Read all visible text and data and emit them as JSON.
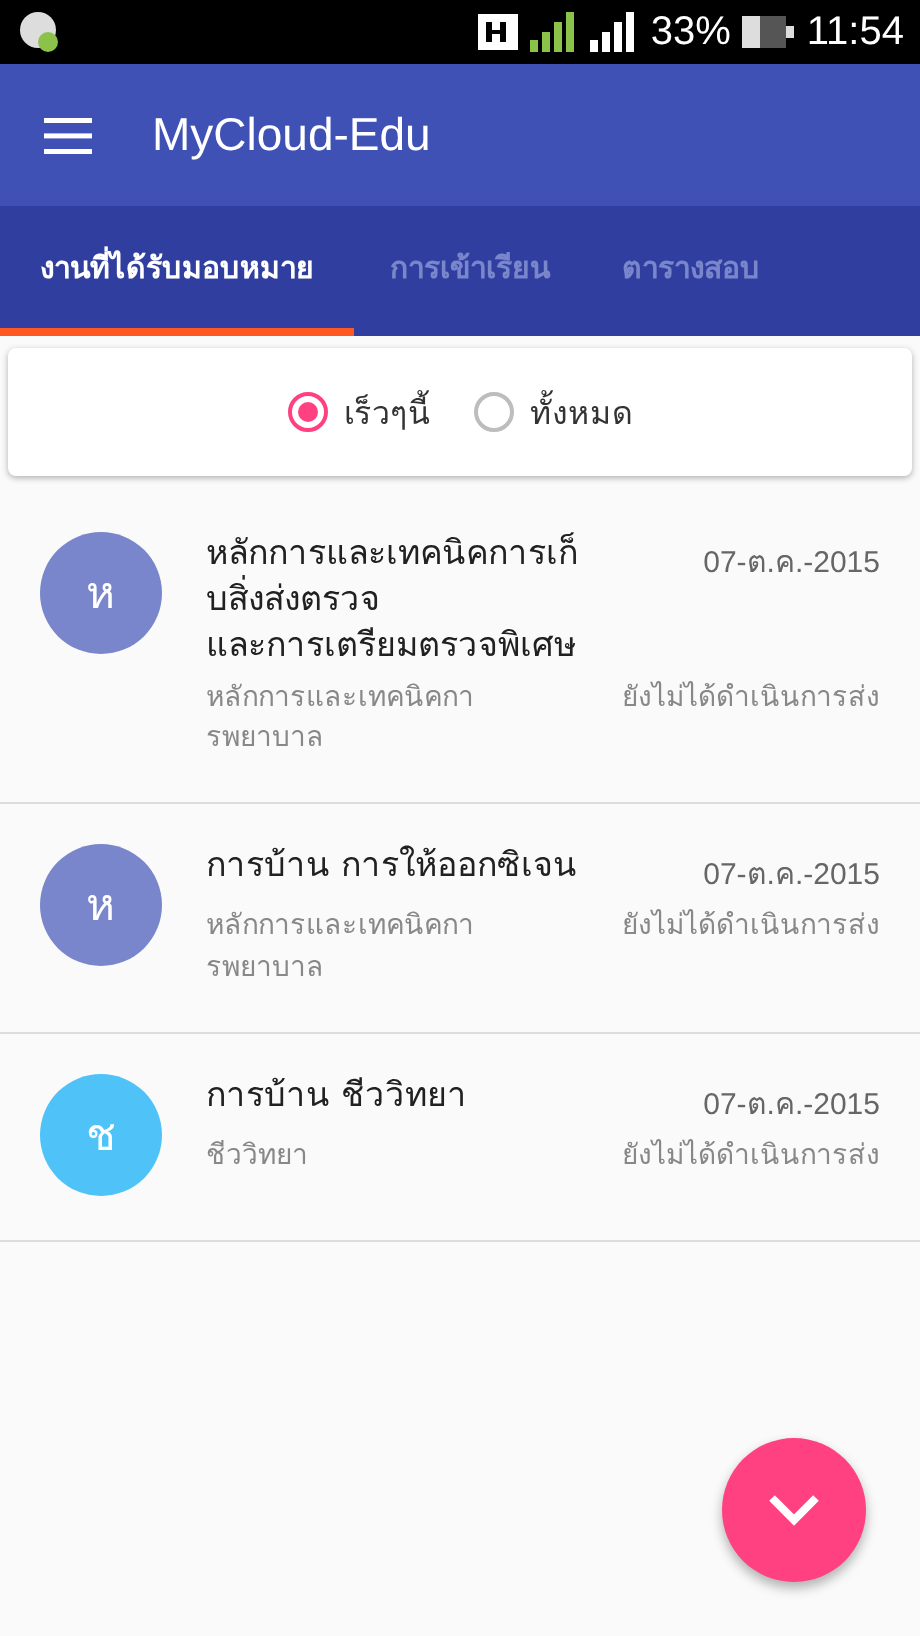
{
  "status_bar": {
    "battery_text": "33%",
    "time": "11:54"
  },
  "app_bar": {
    "title": "MyCloud-Edu"
  },
  "tabs": [
    {
      "label": "งานที่ได้รับมอบหมาย",
      "selected": true
    },
    {
      "label": "การเข้าเรียน",
      "selected": false
    },
    {
      "label": "ตารางสอบ",
      "selected": false
    }
  ],
  "filter": [
    {
      "label": "เร็วๆนี้",
      "selected": true
    },
    {
      "label": "ทั้งหมด",
      "selected": false
    }
  ],
  "assignments": [
    {
      "initial": "ห",
      "color": "#7986cb",
      "title": "หลักการและเทคนิคการเก็\nบสิ่งส่งตรวจ\nและการเตรียมตรวจพิเศษ",
      "date": "07-ต.ค.-2015",
      "subject": "หลักการและเทคนิคกา\nรพยาบาล",
      "status": "ยังไม่ได้ดำเนินการส่ง"
    },
    {
      "initial": "ห",
      "color": "#7986cb",
      "title": "การบ้าน การให้ออกซิเจน",
      "date": "07-ต.ค.-2015",
      "subject": "หลักการและเทคนิคกา\nรพยาบาล",
      "status": "ยังไม่ได้ดำเนินการส่ง"
    },
    {
      "initial": "ช",
      "color": "#4fc3f7",
      "title": "การบ้าน ชีววิทยา",
      "date": "07-ต.ค.-2015",
      "subject": "ชีววิทยา",
      "status": "ยังไม่ได้ดำเนินการส่ง"
    }
  ]
}
